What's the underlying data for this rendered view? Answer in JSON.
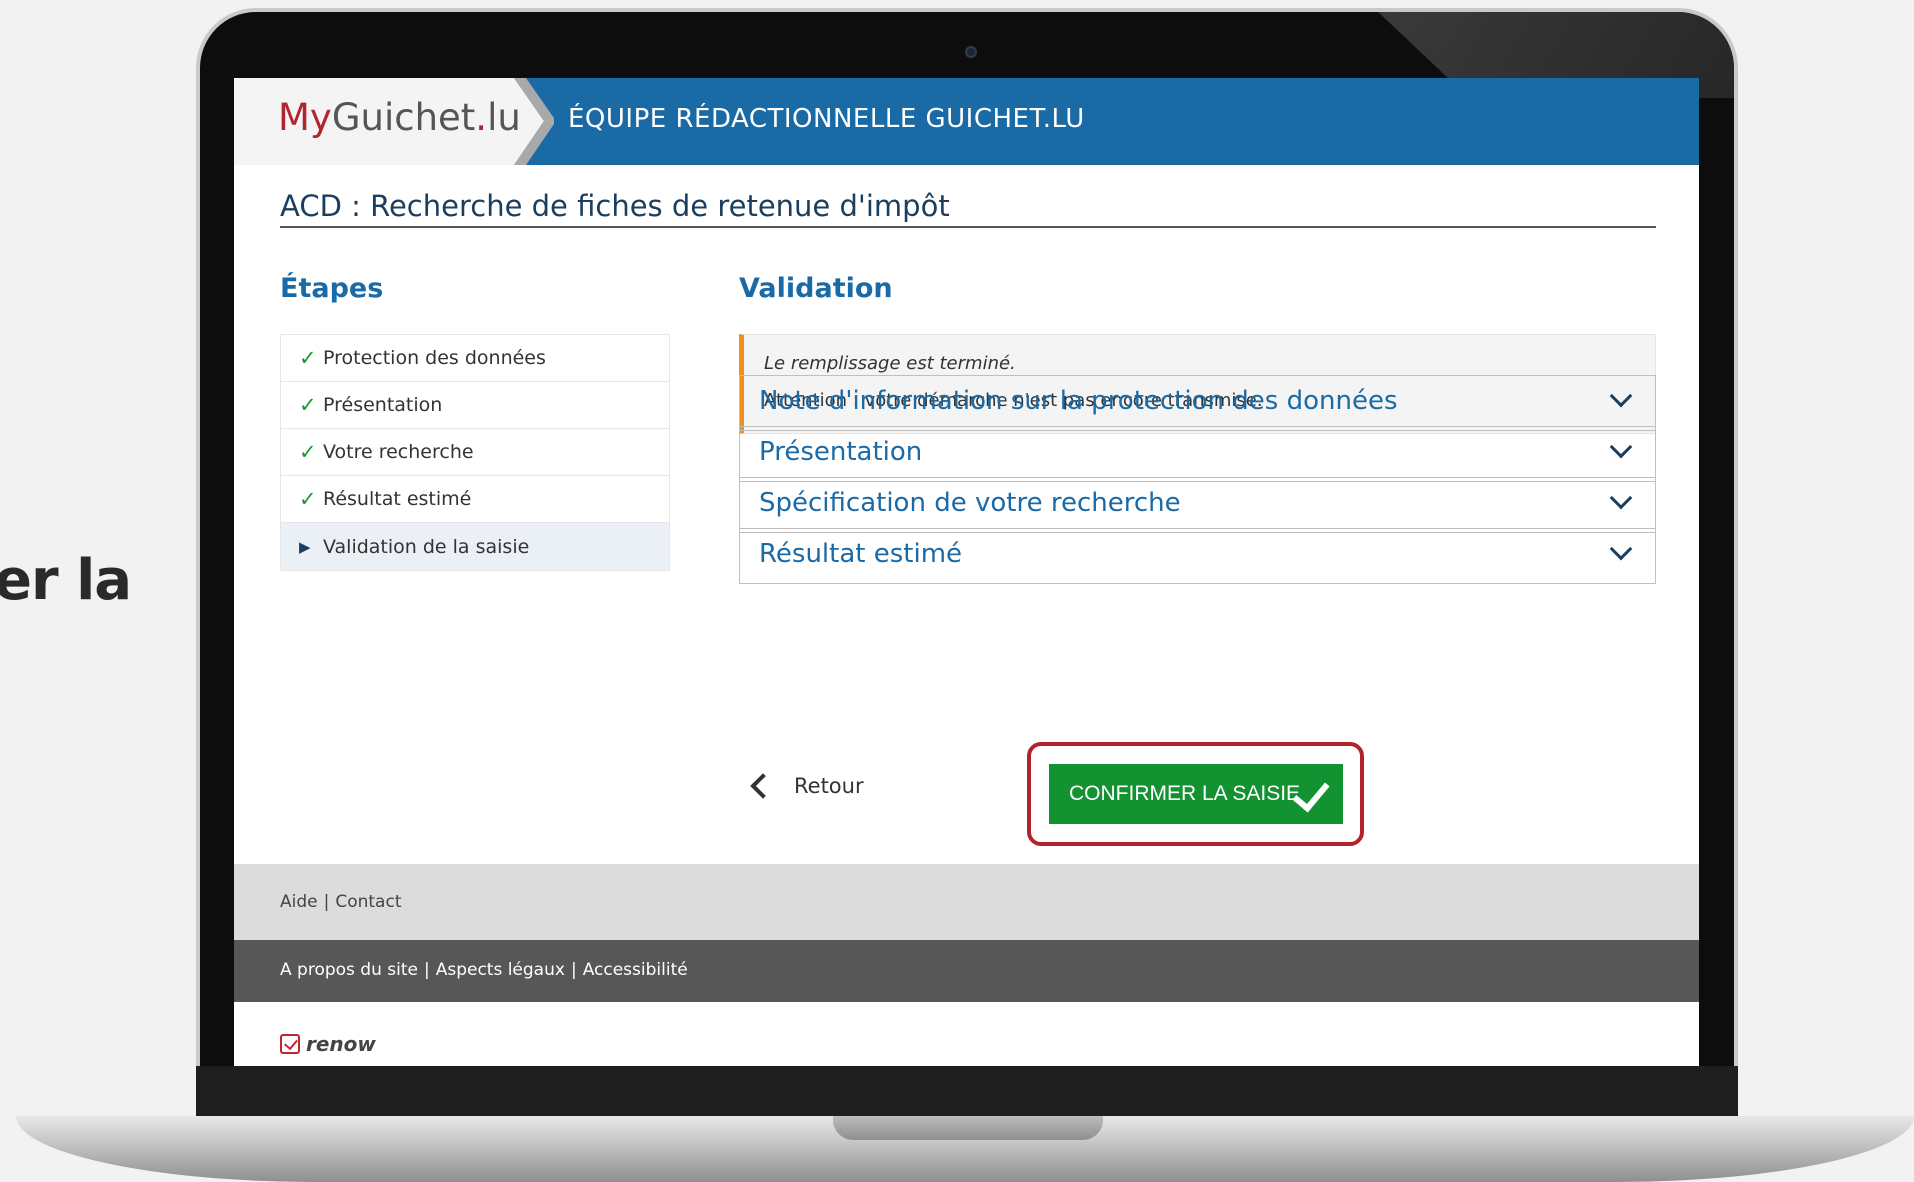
{
  "side_text": "er la",
  "header": {
    "logo_my": "My",
    "logo_guichet": "Guichet",
    "logo_dot": ".",
    "logo_lu": "lu",
    "team": "ÉQUIPE RÉDACTIONNELLE GUICHET.LU"
  },
  "page_title": "ACD : Recherche de fiches de retenue d'impôt",
  "steps": {
    "heading": "Étapes",
    "items": [
      {
        "label": "Protection des données",
        "state": "done"
      },
      {
        "label": "Présentation",
        "state": "done"
      },
      {
        "label": "Votre recherche",
        "state": "done"
      },
      {
        "label": "Résultat estimé",
        "state": "done"
      },
      {
        "label": "Validation de la saisie",
        "state": "current"
      }
    ]
  },
  "validation": {
    "heading": "Validation",
    "alert_line1": "Le remplissage est terminé.",
    "alert_line2": "Attention : votre démarche n'est pas encore transmise.",
    "accordions": [
      "Note d'information sur la protection des données",
      "Présentation",
      "Spécification de votre recherche",
      "Résultat estimé"
    ]
  },
  "actions": {
    "back_label": "Retour",
    "confirm_label": "CONFIRMER LA SAISIE"
  },
  "footer": {
    "help": "Aide",
    "contact": "Contact",
    "about": "A propos du site",
    "legal": "Aspects légaux",
    "accessibility": "Accessibilité",
    "brand": "renow"
  },
  "colors": {
    "header_blue": "#1a6aa6",
    "confirm_green": "#129230",
    "highlight_red": "#b0232d",
    "alert_orange": "#f0901f"
  }
}
